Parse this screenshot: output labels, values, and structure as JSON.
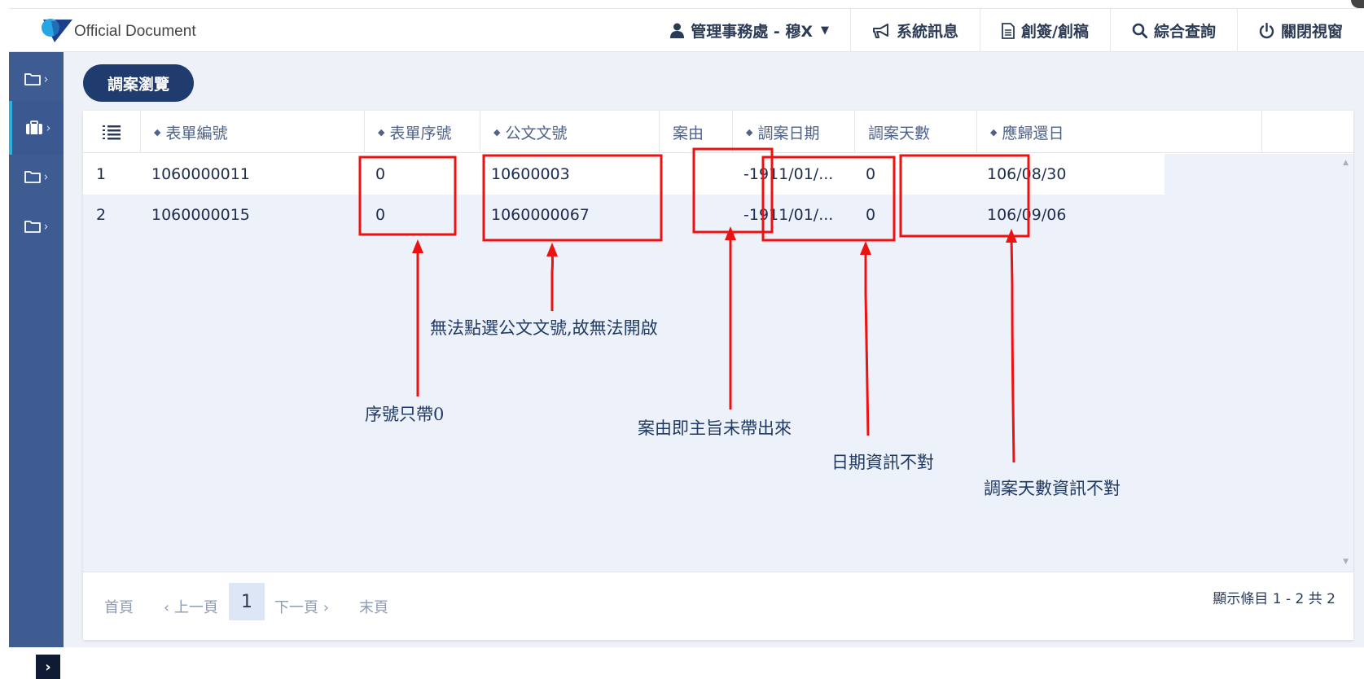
{
  "header": {
    "brand": "Official Document",
    "nav": [
      {
        "icon": "user-icon",
        "label": "管理事務處 - 穆X",
        "dropdown": true
      },
      {
        "icon": "megaphone-icon",
        "label": "系統訊息"
      },
      {
        "icon": "document-icon",
        "label": "創簽/創稿"
      },
      {
        "icon": "search-icon",
        "label": "綜合查詢"
      },
      {
        "icon": "power-icon",
        "label": "關閉視窗"
      }
    ]
  },
  "sidebar": {
    "items": [
      {
        "icon": "folder-icon"
      },
      {
        "icon": "briefcase-icon",
        "active": true
      },
      {
        "icon": "folder-icon"
      },
      {
        "icon": "folder-icon"
      }
    ],
    "toggle_icon": "chevron-right-icon"
  },
  "page": {
    "title": "調案瀏覽"
  },
  "table": {
    "columns": [
      "",
      "表單編號",
      "表單序號",
      "公文文號",
      "案由",
      "調案日期",
      "調案天數",
      "應歸還日"
    ],
    "rows": [
      [
        "1",
        "1060000011",
        "0",
        "10600003",
        "",
        "-1911/01/...",
        "0",
        "106/08/30"
      ],
      [
        "2",
        "1060000015",
        "0",
        "1060000067",
        "",
        "-1911/01/...",
        "0",
        "106/09/06"
      ]
    ]
  },
  "pagination": {
    "first": "首頁",
    "prev": "‹ 上一頁",
    "current": "1",
    "next": "下一頁 ›",
    "last": "末頁",
    "info": "顯示條目 1 - 2 共 2"
  },
  "annotations": {
    "color": "#ee1111",
    "notes": [
      "無法點選公文文號,故無法開啟",
      "序號只帶0",
      "案由即主旨未帶出來",
      "日期資訊不對",
      "調案天數資訊不對"
    ]
  }
}
